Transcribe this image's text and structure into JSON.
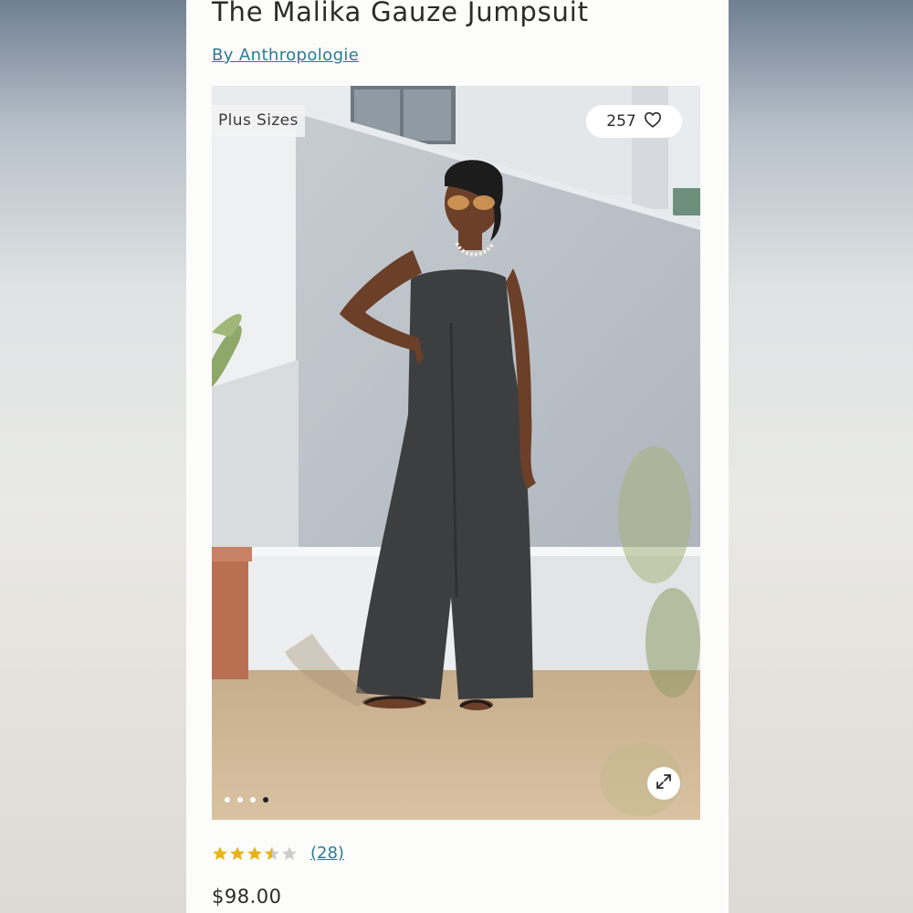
{
  "product": {
    "title": "The Malika Gauze Jumpsuit",
    "brand_link": "By Anthropologie",
    "price": "$98.00"
  },
  "image": {
    "badge": "Plus Sizes",
    "favorites_count": "257",
    "favorite_icon": "heart-icon",
    "expand_icon": "expand-arrows-icon",
    "carousel_total": 4,
    "carousel_active": 4,
    "alt": "Model wearing a black gauze jumpsuit in front of a white wall"
  },
  "rating": {
    "value": 3.5,
    "max": 5,
    "reviews_label": "(28)"
  },
  "colors": {
    "link": "#2e7a95",
    "star_filled": "#e7b416",
    "star_empty": "#cccccc",
    "text": "#2b2b2b"
  }
}
